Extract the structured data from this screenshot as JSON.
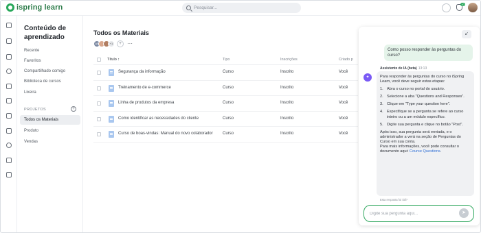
{
  "topbar": {
    "logo_text": "ispring learn",
    "search_placeholder": "Pesquisar...",
    "notifications_count": "10"
  },
  "sidebar": {
    "title": "Conteúdo de aprendizado",
    "items": [
      {
        "label": "Recente"
      },
      {
        "label": "Favoritos"
      },
      {
        "label": "Compartilhado comigo"
      },
      {
        "label": "Biblioteca de cursos"
      },
      {
        "label": "Lixeira"
      }
    ],
    "projects_header": "PROJETOS",
    "projects": [
      {
        "label": "Todos os Materiais",
        "active": true
      },
      {
        "label": "Produto",
        "active": false
      },
      {
        "label": "Vendas",
        "active": false
      }
    ]
  },
  "main": {
    "title": "Todos os Materiais",
    "avatar_initials": "AS",
    "avatar_more": "+1",
    "columns": {
      "title": "Título ↑",
      "type": "Tipo",
      "enrollments": "Inscrições",
      "created_by": "Criado p"
    },
    "rows": [
      {
        "title": "Segurança da informação",
        "type": "Curso",
        "enrollments": "Inscrito",
        "created_by": "Você"
      },
      {
        "title": "Treinamento de e-commerce",
        "type": "Curso",
        "enrollments": "Inscrito",
        "created_by": "Você"
      },
      {
        "title": "Linha de produtos da empresa",
        "type": "Curso",
        "enrollments": "Inscrito",
        "created_by": "Você"
      },
      {
        "title": "Como identificar as necessidades do cliente",
        "type": "Curso",
        "enrollments": "Inscrito",
        "created_by": "Você"
      },
      {
        "title": "Curso de boas-vindas: Manual do novo colaborador",
        "type": "Curso",
        "enrollments": "Inscrito",
        "created_by": "Você"
      }
    ]
  },
  "chat": {
    "collapse_icon": "↙",
    "user_message": "Como posso responder às perguntas do curso?",
    "bot_name": "Assistente de IA (beta)",
    "bot_time": "13:13",
    "bot_intro": "Para responder às perguntas do curso no iSpring Learn, você deve seguir estas etapas:",
    "steps": [
      {
        "n": "1.",
        "text": "Abra o curso no portal do usuário."
      },
      {
        "n": "2.",
        "text": "Selecione a aba \"Questions and Responses\"."
      },
      {
        "n": "3.",
        "text": "Clique em \"Type your question here\"."
      },
      {
        "n": "4.",
        "text": "Especifique se a pergunta se refere ao curso inteiro ou a um módulo específico."
      },
      {
        "n": "5.",
        "text": "Digite sua pergunta e clique no botão \"Post\"."
      }
    ],
    "bot_after": "Após isso, sua pergunta será enviada, e o administrador a verá na seção de Perguntas do Curso em sua conta.",
    "bot_more": "Para mais informações, você pode consultar o documento aqui: ",
    "bot_link": "Course Questions",
    "bot_link_end": ".",
    "bot_note": "Esta resposta foi útil?",
    "input_placeholder": "Digite sua pergunta aqui..."
  },
  "colors": {
    "brand": "#27a85a",
    "link": "#2f6fd6",
    "bot_accent": "#7a5af5"
  }
}
